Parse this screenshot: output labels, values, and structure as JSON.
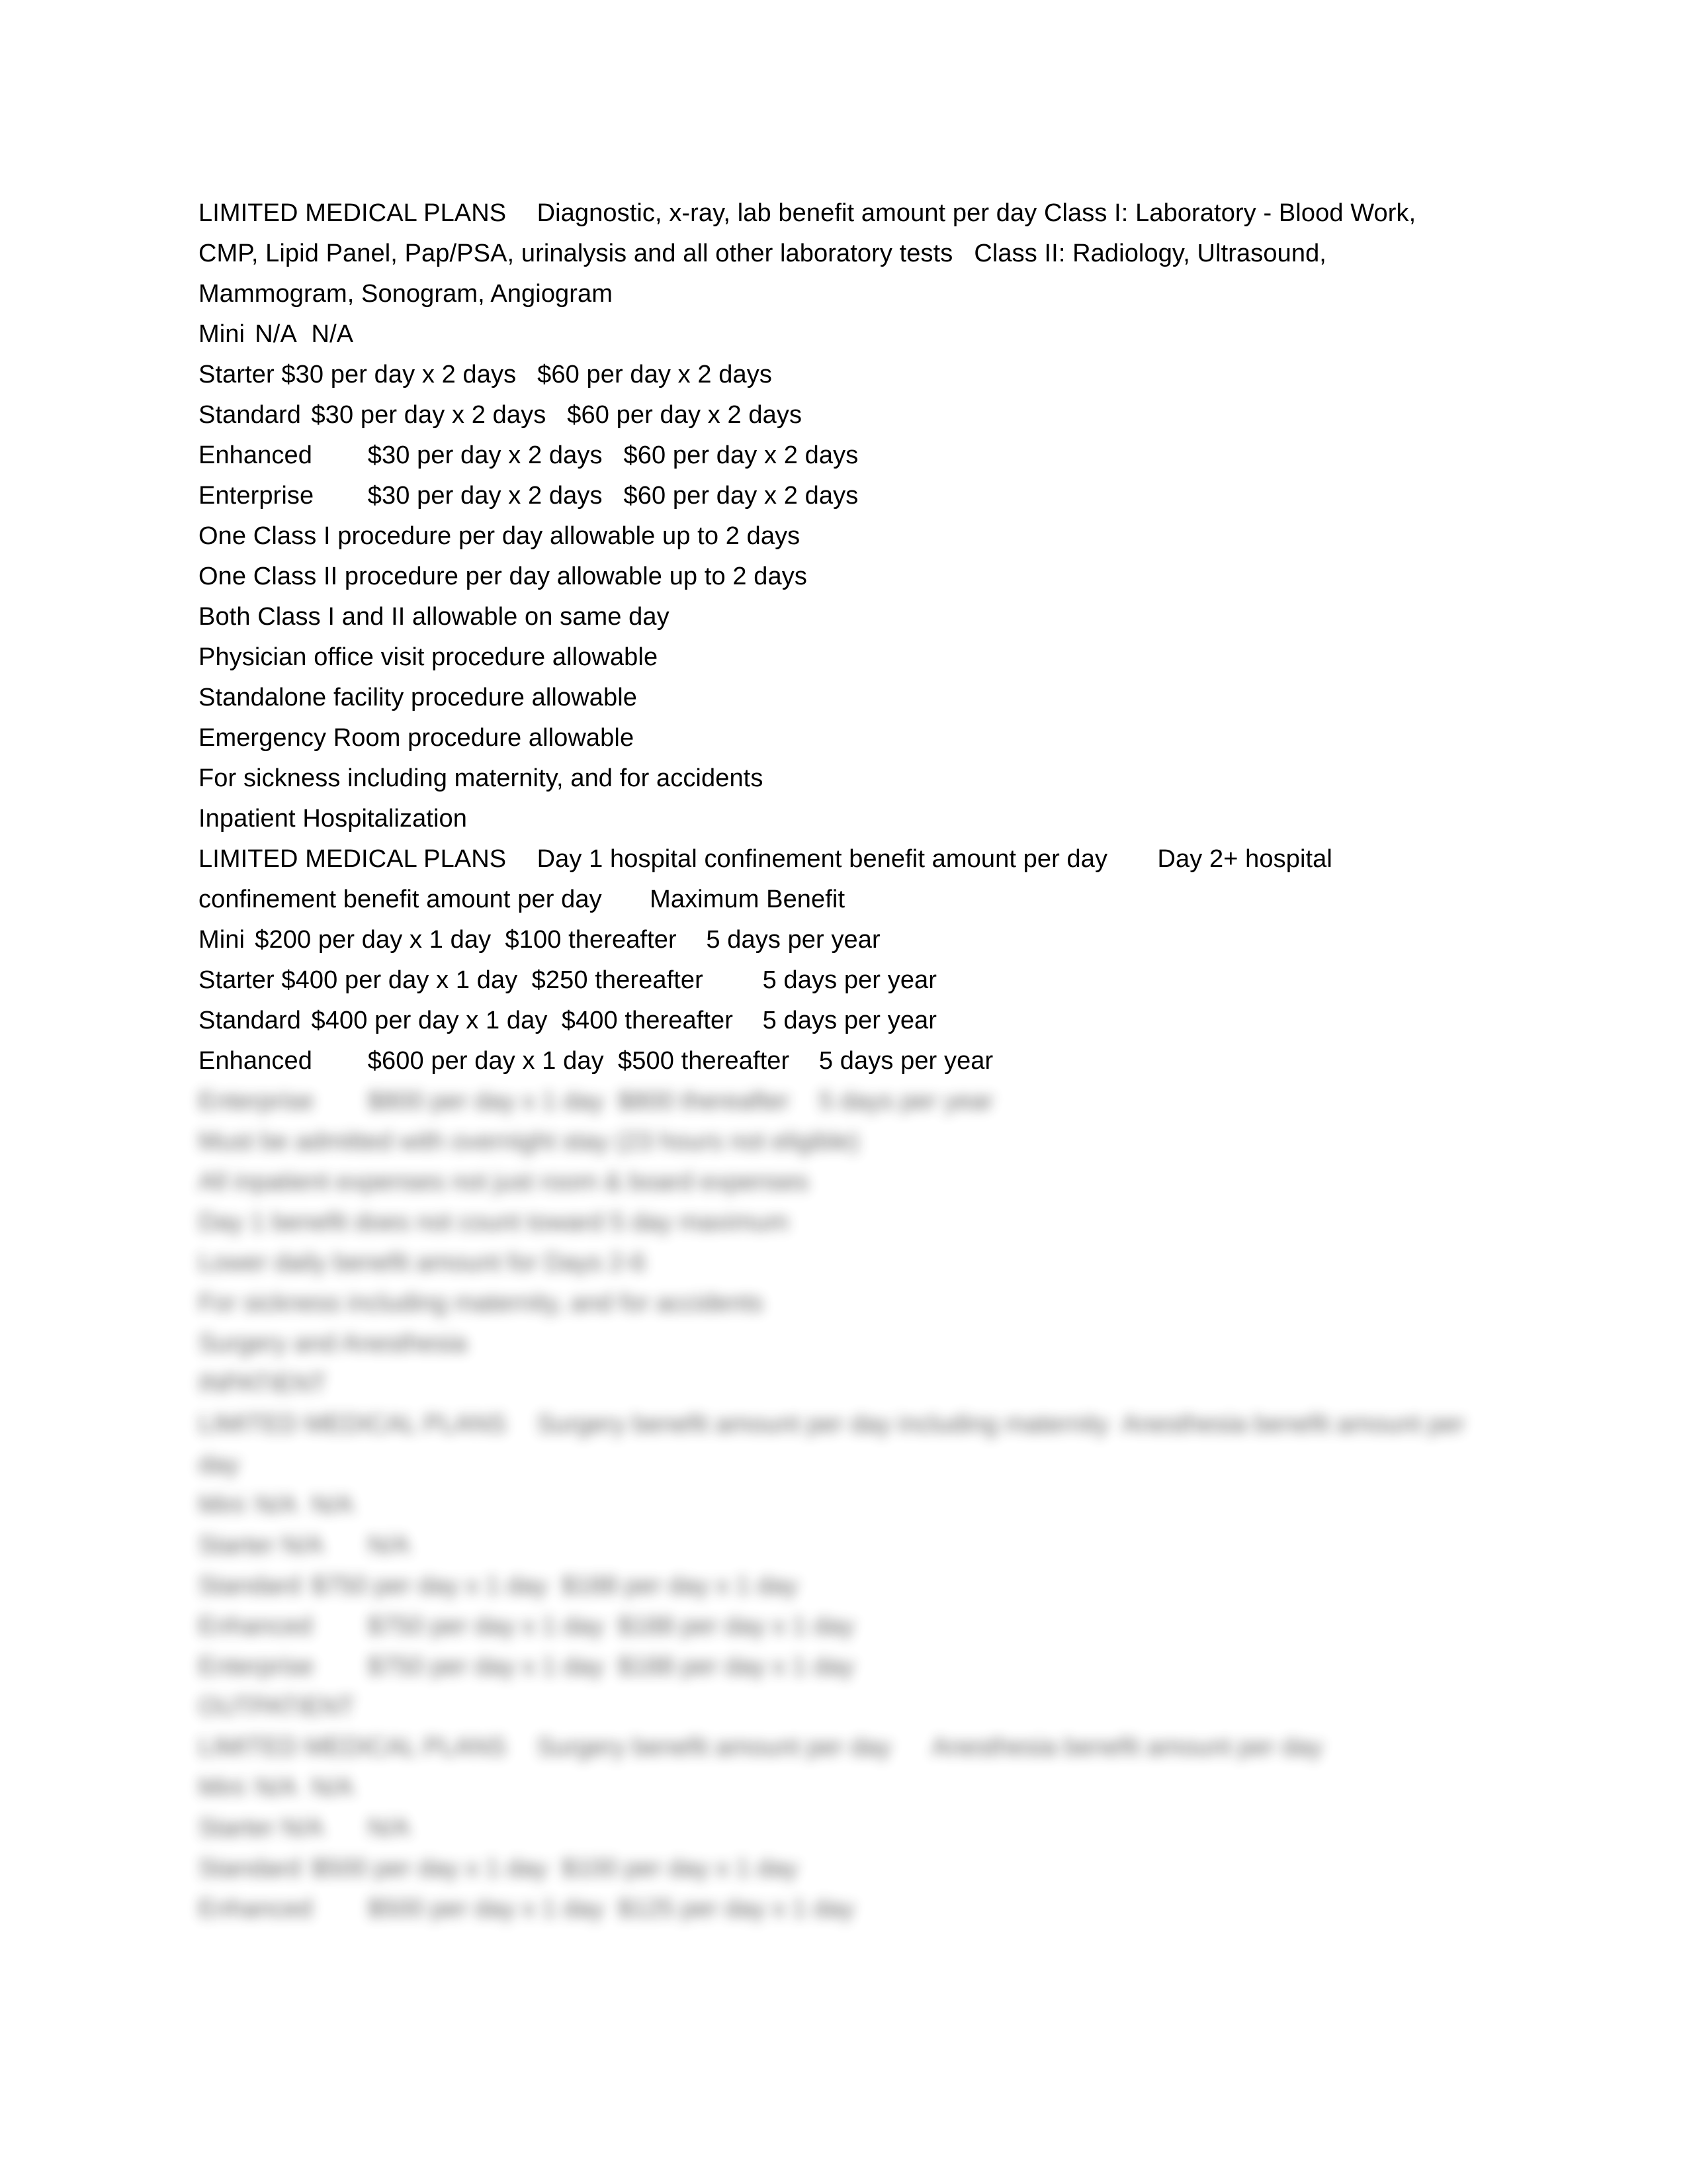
{
  "document": {
    "page_background": "#ffffff",
    "text_color": "#000000",
    "sections": {
      "diagnostic": {
        "heading_line1": "LIMITED MEDICAL PLANS\tDiagnostic, x-ray, lab benefit amount per day Class I: Laboratory - Blood Work, CMP, Lipid Panel, Pap/PSA, urinalysis and all other laboratory tests   Class II: Radiology, Ultrasound, Mammogram, Sonogram, Angiogram",
        "rows": [
          "Mini\tN/A\tN/A",
          "Starter $30 per day x 2 days   $60 per day x 2 days",
          "Standard\t$30 per day x 2 days   $60 per day x 2 days",
          "Enhanced\t$30 per day x 2 days   $60 per day x 2 days",
          "Enterprise\t$30 per day x 2 days   $60 per day x 2 days"
        ],
        "notes": [
          "One Class I procedure per day allowable up to 2 days",
          "One Class II procedure per day allowable up to 2 days",
          "Both Class I and II allowable on same day",
          "Physician office visit procedure allowable",
          "Standalone facility procedure allowable",
          "Emergency Room procedure allowable",
          "For sickness including maternity, and for accidents"
        ]
      },
      "inpatient": {
        "section_title": "Inpatient Hospitalization",
        "heading": "LIMITED MEDICAL PLANS\tDay 1 hospital confinement benefit amount per day\tDay 2+ hospital confinement benefit amount per day\tMaximum Benefit",
        "rows": [
          "Mini\t$200 per day x 1 day  $100 thereafter\t5 days per year",
          "Starter $400 per day x 1 day  $250 thereafter\t5 days per year",
          "Standard\t$400 per day x 1 day  $400 thereafter\t5 days per year",
          "Enhanced\t$600 per day x 1 day  $500 thereafter\t5 days per year"
        ]
      },
      "blurred": {
        "note": "This lower region of the page is visually blurred/illegible in the screenshot.",
        "lines": [
          "Enterprise\t$800 per day x 1 day  $800 thereafter\t5 days per year",
          "Must be admitted with overnight stay (23 hours not eligible)",
          "All inpatient expenses not just room & board expenses",
          "Day 1 benefit does not count toward 5 day maximum",
          "Lower daily benefit amount for Days 2-6",
          "For sickness including maternity, and for accidents",
          "Surgery and Anesthesia",
          "INPATIENT",
          "LIMITED MEDICAL PLANS\tSurgery benefit amount per day including maternity  Anesthesia benefit amount per day",
          "Mini\tN/A\tN/A",
          "Starter N/A\tN/A",
          "Standard\t$750 per day x 1 day  $188 per day x 1 day",
          "Enhanced\t$750 per day x 1 day  $188 per day x 1 day",
          "Enterprise\t$750 per day x 1 day  $188 per day x 1 day",
          "OUTPATIENT",
          "LIMITED MEDICAL PLANS\tSurgery benefit amount per day\tAnesthesia benefit amount per day",
          "Mini\tN/A\tN/A",
          "Starter N/A\tN/A",
          "Standard\t$500 per day x 1 day  $100 per day x 1 day",
          "Enhanced\t$500 per day x 1 day  $125 per day x 1 day"
        ]
      }
    }
  }
}
